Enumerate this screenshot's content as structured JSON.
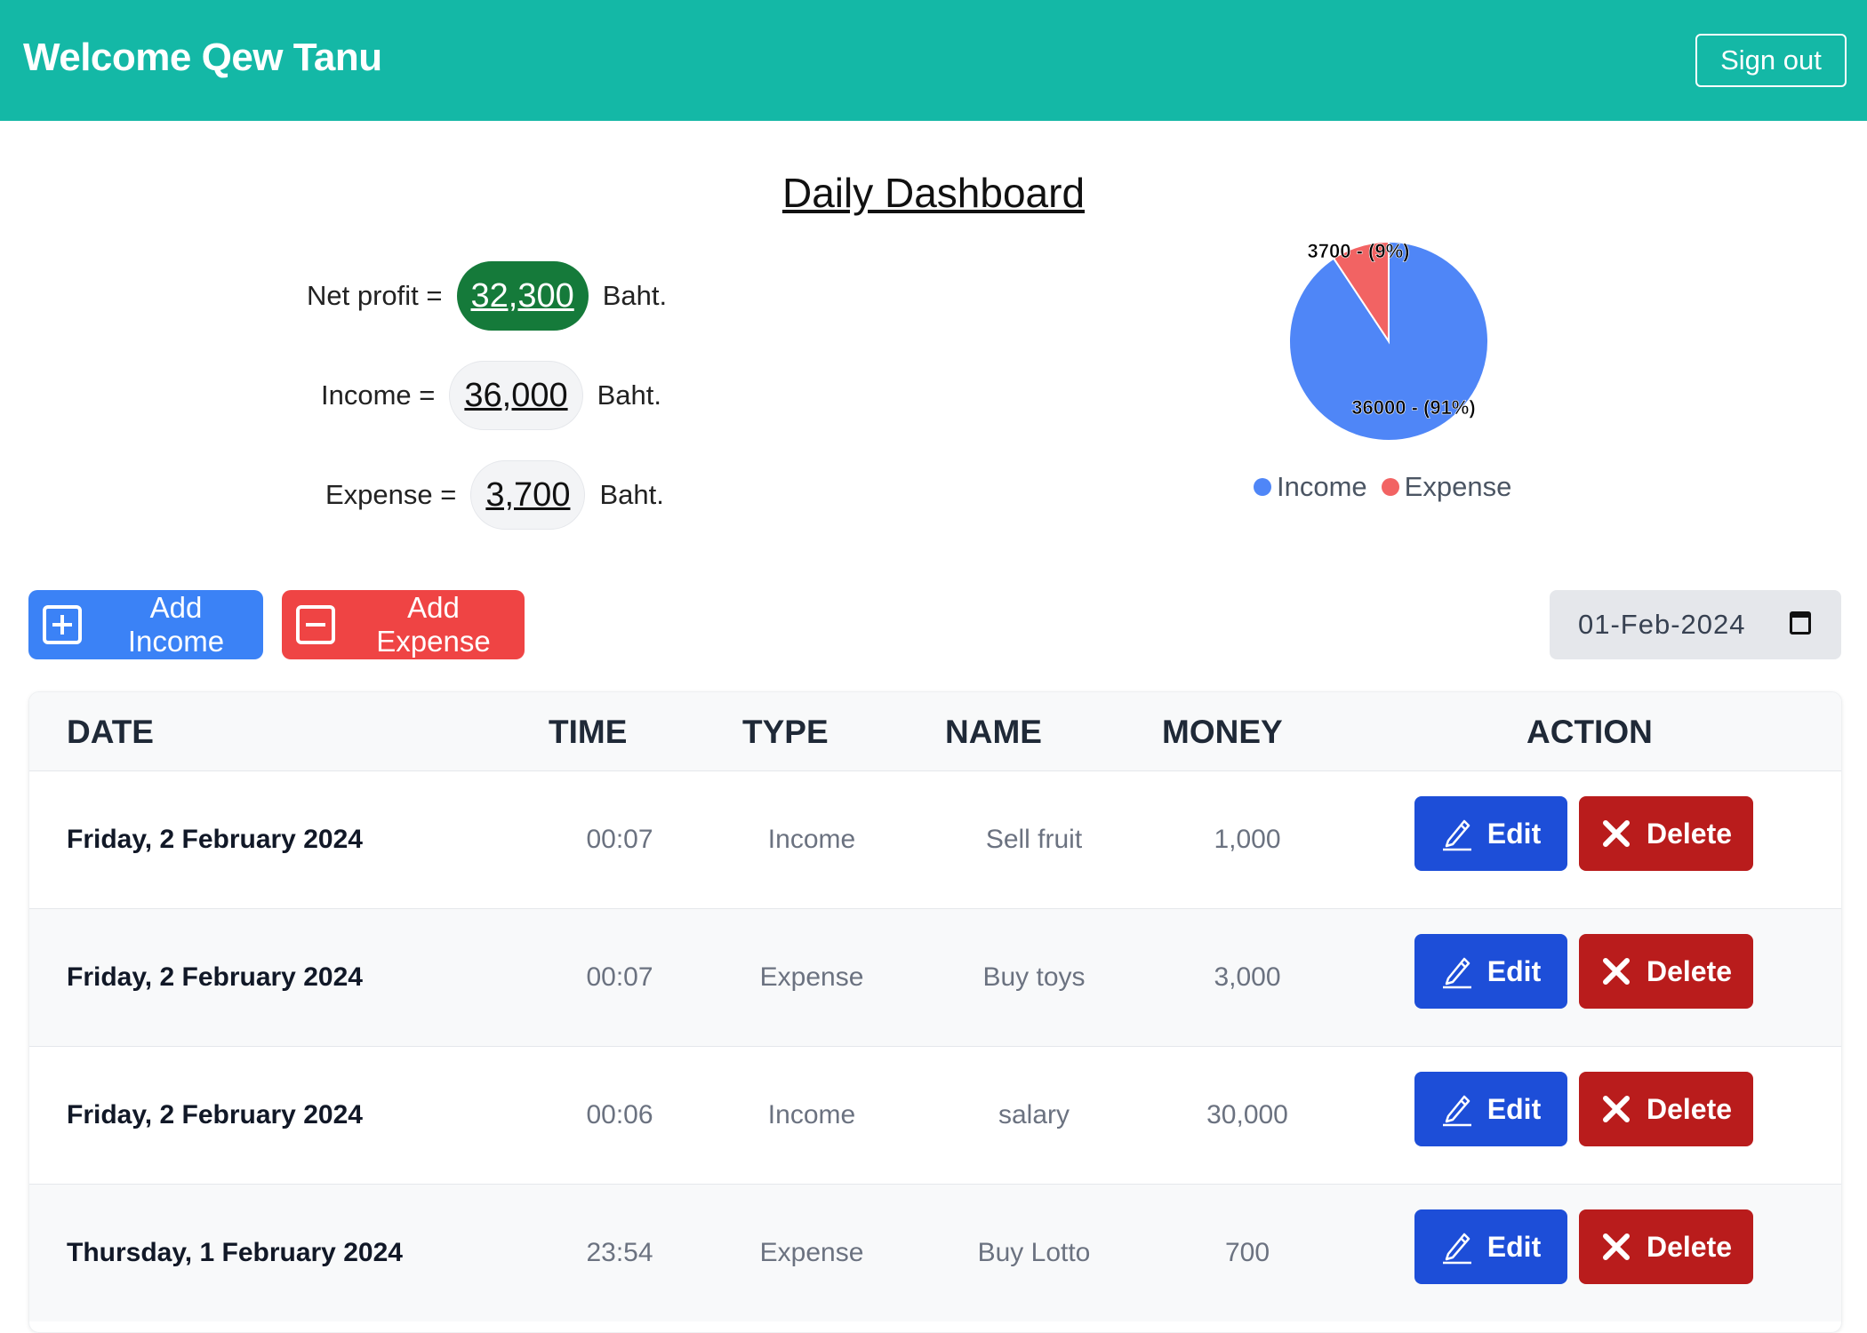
{
  "header": {
    "welcome": "Welcome Qew Tanu",
    "sign_out": "Sign out"
  },
  "title": "Daily Dashboard",
  "summary": {
    "net_profit_label": "Net profit =",
    "net_profit_value": "32,300",
    "income_label": "Income =",
    "income_value": "36,000",
    "expense_label": "Expense =",
    "expense_value": "3,700",
    "unit": "Baht."
  },
  "chart_data": {
    "type": "pie",
    "categories": [
      "Income",
      "Expense"
    ],
    "values": [
      36000,
      3700
    ],
    "labels": [
      "36000 - (91%)",
      "3700 - (9%)"
    ],
    "colors": [
      "#4f86f7",
      "#f26363"
    ],
    "legend_position": "bottom"
  },
  "actions": {
    "add_income": "Add Income",
    "add_expense": "Add Expense",
    "date_value": "01-Feb-2024"
  },
  "table": {
    "headers": {
      "date": "DATE",
      "time": "TIME",
      "type": "TYPE",
      "name": "NAME",
      "money": "MONEY",
      "action": "ACTION"
    },
    "edit_label": "Edit",
    "delete_label": "Delete",
    "rows": [
      {
        "date": "Friday, 2 February 2024",
        "time": "00:07",
        "type": "Income",
        "name": "Sell fruit",
        "money": "1,000"
      },
      {
        "date": "Friday, 2 February 2024",
        "time": "00:07",
        "type": "Expense",
        "name": "Buy toys",
        "money": "3,000"
      },
      {
        "date": "Friday, 2 February 2024",
        "time": "00:06",
        "type": "Income",
        "name": "salary",
        "money": "30,000"
      },
      {
        "date": "Thursday, 1 February 2024",
        "time": "23:54",
        "type": "Expense",
        "name": "Buy Lotto",
        "money": "700"
      }
    ]
  },
  "icons": {
    "add_income": "plus-square-icon",
    "add_expense": "minus-square-icon",
    "date": "calendar-icon",
    "edit": "pencil-icon",
    "delete": "x-icon"
  }
}
